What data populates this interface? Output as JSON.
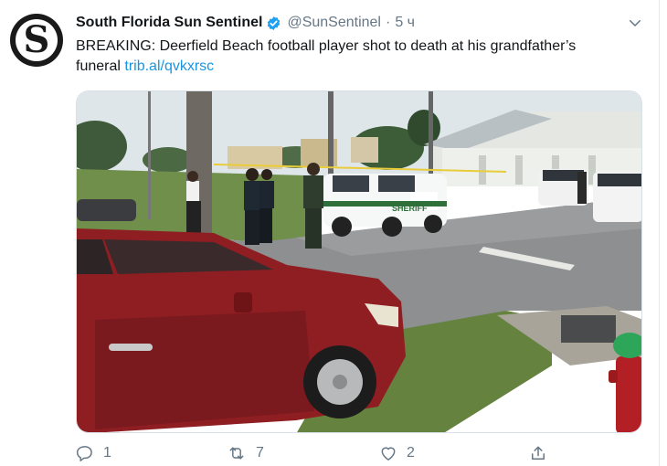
{
  "account": {
    "avatar_letter": "S",
    "display_name": "South Florida Sun Sentinel",
    "handle": "@SunSentinel",
    "separator": "·",
    "time": "5 ч"
  },
  "tweet": {
    "text_line1": "BREAKING: Deerfield Beach football player shot to death at his grandfather’s",
    "text_line2": "funeral",
    "link": "trib.al/qvkxrsc"
  },
  "photo": {
    "vehicle_door_text": "SHERIFF"
  },
  "actions": {
    "reply_count": "1",
    "retweet_count": "7",
    "like_count": "2"
  },
  "icons": {
    "verified": "verified-badge-icon",
    "more": "chevron-down-icon",
    "reply": "reply-icon",
    "retweet": "retweet-icon",
    "like": "like-icon",
    "share": "share-icon"
  },
  "colors": {
    "link": "#1b95e0",
    "verified": "#1da1f2",
    "muted": "#657786"
  }
}
